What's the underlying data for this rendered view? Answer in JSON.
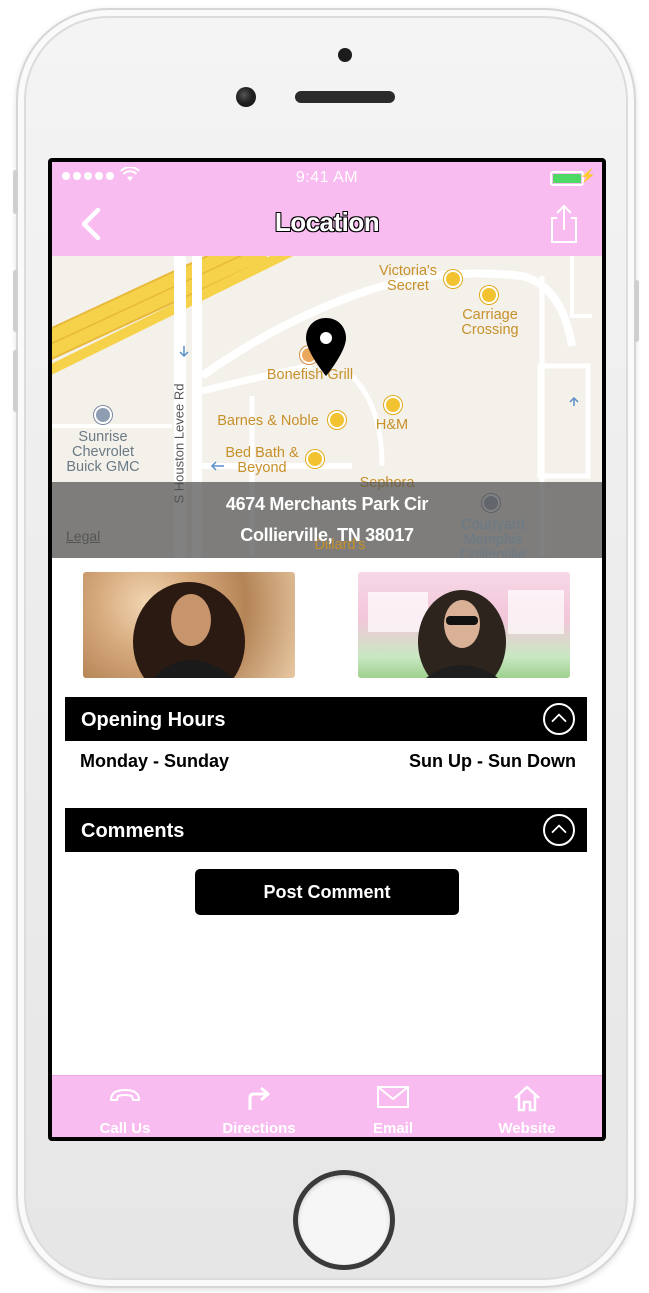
{
  "status_bar": {
    "time": "9:41 AM"
  },
  "nav": {
    "title": "Location",
    "back_icon": "chevron-left-icon",
    "share_icon": "share-icon"
  },
  "map": {
    "labels": {
      "victorias_secret": "Victoria's Secret",
      "carriage_crossing": "Carriage Crossing",
      "bonefish_grill": "Bonefish Grill",
      "barnes_noble": "Barnes & Noble",
      "hm": "H&M",
      "bed_bath_beyond": "Bed Bath & Beyond",
      "sephora": "Sephora",
      "sunrise_chevrolet": "Sunrise Chevrolet Buick GMC",
      "courtyard": "Courtyard Memphis Collierville",
      "dillards": "Dillard's",
      "road": "S Houston Levee Rd"
    },
    "legal": "Legal",
    "address_line1": "4674 Merchants Park Cir",
    "address_line2": "Collierville, TN 38017"
  },
  "opening_hours": {
    "title": "Opening Hours",
    "day_range": "Monday - Sunday",
    "hours": "Sun Up - Sun Down"
  },
  "comments": {
    "title": "Comments",
    "post_button": "Post Comment"
  },
  "tabbar": {
    "items": [
      {
        "label": "Call Us",
        "icon": "phone-icon"
      },
      {
        "label": "Directions",
        "icon": "directions-icon"
      },
      {
        "label": "Email",
        "icon": "email-icon"
      },
      {
        "label": "Website",
        "icon": "home-icon"
      }
    ]
  },
  "colors": {
    "accent": "#f9bcf0",
    "map_bg": "#f4f1ea",
    "highway": "#f6d24a",
    "battery": "#4cd964"
  }
}
